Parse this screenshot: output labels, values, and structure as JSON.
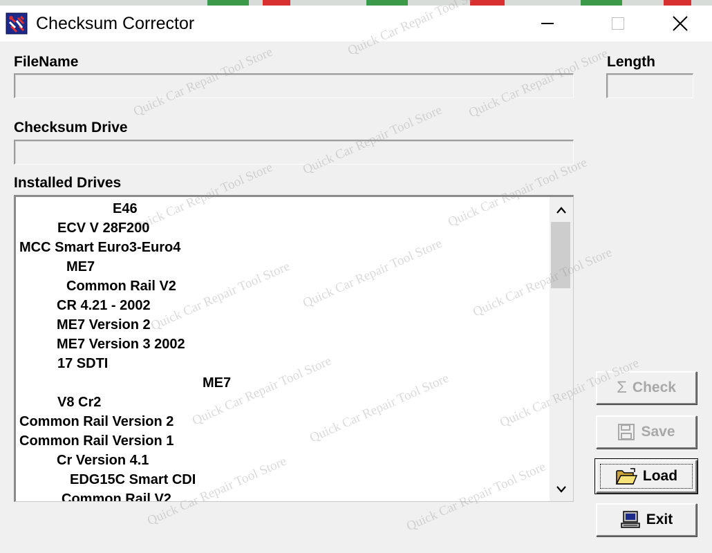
{
  "window": {
    "title": "Checksum Corrector",
    "controls": [
      "minimize",
      "maximize",
      "close"
    ]
  },
  "fields": {
    "filename_label": "FileName",
    "filename_value": "",
    "length_label": "Length",
    "length_value": "",
    "checksum_drive_label": "Checksum Drive",
    "checksum_drive_value": ""
  },
  "installed_drives": {
    "label": "Installed Drives",
    "items": [
      "E46",
      "ECV V 28F200",
      "MCC Smart Euro3-Euro4",
      "ME7",
      "Common Rail V2",
      "CR 4.21 - 2002",
      "ME7 Version 2",
      "ME7 Version 3 2002",
      "17 SDTI",
      "ME7",
      "V8 Cr2",
      "Common Rail Version 2",
      "Common Rail Version 1",
      "Cr Version 4.1",
      "EDG15C Smart CDI",
      "Common Rail V2"
    ]
  },
  "buttons": {
    "check": "Check",
    "save": "Save",
    "load": "Load",
    "exit": "Exit"
  },
  "watermark": "Quick Car Repair Tool Store"
}
